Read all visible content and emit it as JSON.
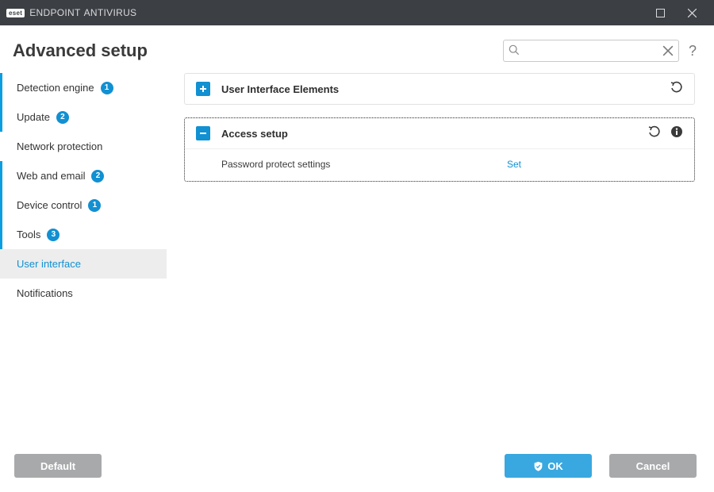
{
  "titlebar": {
    "brand_badge": "eset",
    "brand_name": "ENDPOINT",
    "brand_product": "ANTIVIRUS"
  },
  "header": {
    "title": "Advanced setup",
    "search_placeholder": ""
  },
  "sidebar": {
    "items": [
      {
        "label": "Detection engine",
        "badge": "1",
        "indicator": true,
        "active": false
      },
      {
        "label": "Update",
        "badge": "2",
        "indicator": true,
        "active": false
      },
      {
        "label": "Network protection",
        "badge": null,
        "indicator": false,
        "active": false
      },
      {
        "label": "Web and email",
        "badge": "2",
        "indicator": true,
        "active": false
      },
      {
        "label": "Device control",
        "badge": "1",
        "indicator": true,
        "active": false
      },
      {
        "label": "Tools",
        "badge": "3",
        "indicator": true,
        "active": false
      },
      {
        "label": "User interface",
        "badge": null,
        "indicator": false,
        "active": true
      },
      {
        "label": "Notifications",
        "badge": null,
        "indicator": false,
        "active": false
      }
    ]
  },
  "panels": {
    "ui_elements": {
      "title": "User Interface Elements"
    },
    "access_setup": {
      "title": "Access setup",
      "password_row_label": "Password protect settings",
      "password_row_action": "Set"
    }
  },
  "footer": {
    "default_label": "Default",
    "ok_label": "OK",
    "cancel_label": "Cancel"
  }
}
